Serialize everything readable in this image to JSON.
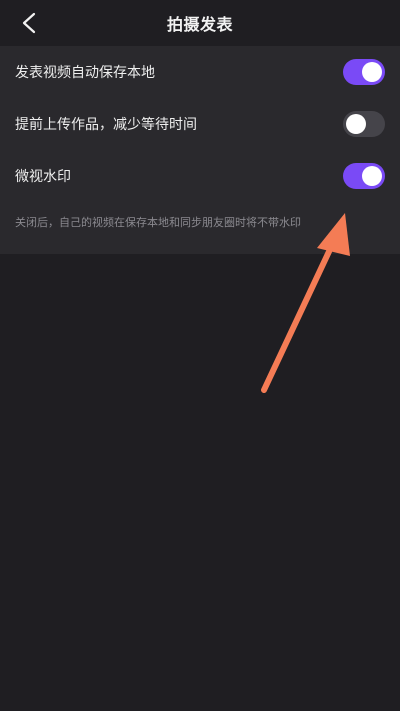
{
  "header": {
    "title": "拍摄发表",
    "back_icon": "chevron-left-icon"
  },
  "settings": [
    {
      "label": "发表视频自动保存本地",
      "enabled": true
    },
    {
      "label": "提前上传作品，减少等待时间",
      "enabled": false
    },
    {
      "label": "微视水印",
      "enabled": true
    }
  ],
  "hint": "关闭后，自己的视频在保存本地和同步朋友圈时将不带水印",
  "colors": {
    "toggle_on": "#7a4af6",
    "toggle_off": "#45444a",
    "annotation_arrow": "#f47c55"
  }
}
